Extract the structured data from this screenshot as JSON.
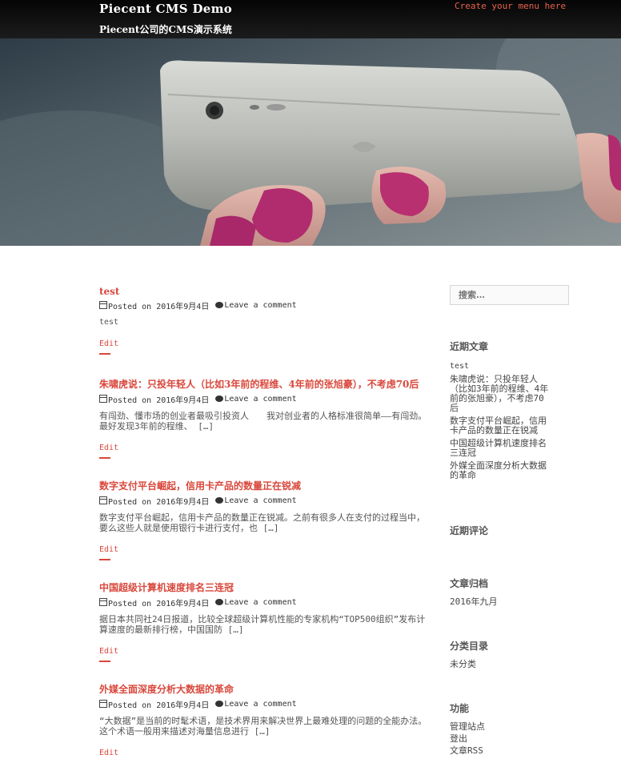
{
  "header": {
    "site_title": "Piecent CMS Demo",
    "site_description": "Piecent公司的CMS演示系统",
    "menu_link": "Create your menu here"
  },
  "posts": [
    {
      "title": "test",
      "posted_on": "Posted on 2016年9月4日",
      "comment": "Leave a comment",
      "excerpt": "test",
      "edit": "Edit"
    },
    {
      "title": "朱啸虎说：只投年轻人（比如3年前的程维、4年前的张旭豪），不考虑70后",
      "posted_on": "Posted on 2016年9月4日",
      "comment": "Leave a comment",
      "excerpt": "有闯劲、懂市场的创业者最吸引投资人　　我对创业者的人格标准很简单——有闯劲。最好发现3年前的程维、 […]",
      "edit": "Edit"
    },
    {
      "title": "数字支付平台崛起，信用卡产品的数量正在锐减",
      "posted_on": "Posted on 2016年9月4日",
      "comment": "Leave a comment",
      "excerpt": "数字支付平台崛起，信用卡产品的数量正在锐减。之前有很多人在支付的过程当中，要么这些人就是使用银行卡进行支付，也 […]",
      "edit": "Edit"
    },
    {
      "title": "中国超级计算机速度排名三连冠",
      "posted_on": "Posted on 2016年9月4日",
      "comment": "Leave a comment",
      "excerpt": "据日本共同社24日报道，比较全球超级计算机性能的专家机构“TOP500组织”发布计算速度的最新排行榜，中国国防 […]",
      "edit": "Edit"
    },
    {
      "title": "外媒全面深度分析大数据的革命",
      "posted_on": "Posted on 2016年9月4日",
      "comment": "Leave a comment",
      "excerpt": "“大数据”是当前的时髦术语，是技术界用来解决世界上最难处理的问题的全能办法。这个术语一般用来描述对海量信息进行 […]",
      "edit": "Edit"
    }
  ],
  "sidebar": {
    "search_placeholder": "搜索…",
    "recent_posts_title": "近期文章",
    "recent_posts": [
      "test",
      "朱啸虎说：只投年轻人（比如3年前的程维、4年前的张旭豪），不考虑70后",
      "数字支付平台崛起，信用卡产品的数量正在锐减",
      "中国超级计算机速度排名三连冠",
      "外媒全面深度分析大数据的革命"
    ],
    "recent_comments_title": "近期评论",
    "archives_title": "文章归档",
    "archives": [
      "2016年九月"
    ],
    "categories_title": "分类目录",
    "categories": [
      "未分类"
    ],
    "meta_title": "功能",
    "meta_links": [
      "管理站点",
      "登出",
      "文章RSS"
    ]
  },
  "colors": {
    "accent": "#d9473b",
    "header_bg": "#0b0b0b"
  }
}
